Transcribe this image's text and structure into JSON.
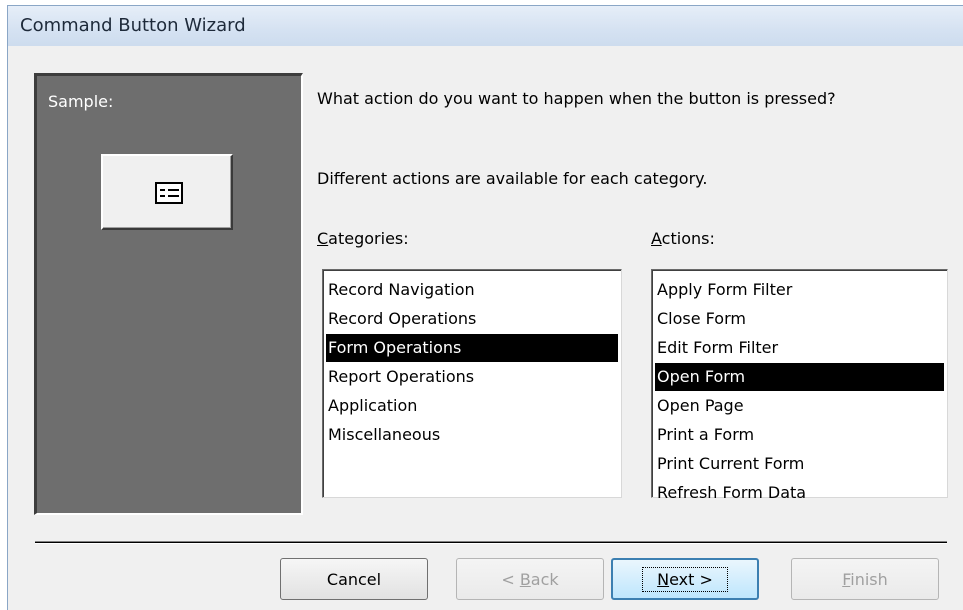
{
  "window": {
    "title": "Command Button Wizard"
  },
  "sample": {
    "label": "Sample:",
    "button_icon": "form-icon"
  },
  "prompt": {
    "question": "What action do you want to happen when the button is pressed?",
    "info": "Different actions are available for each category."
  },
  "categories": {
    "label_prefix": "C",
    "label_rest": "ategories:",
    "items": [
      "Record Navigation",
      "Record Operations",
      "Form Operations",
      "Report Operations",
      "Application",
      "Miscellaneous"
    ],
    "selected": "Form Operations"
  },
  "actions": {
    "label_prefix": "A",
    "label_rest": "ctions:",
    "items": [
      "Apply Form Filter",
      "Close Form",
      "Edit Form Filter",
      "Open Form",
      "Open Page",
      "Print a Form",
      "Print Current Form",
      "Refresh Form Data"
    ],
    "selected": "Open Form"
  },
  "buttons": {
    "cancel": "Cancel",
    "back_pre": "< ",
    "back_key": "B",
    "back_rest": "ack",
    "next_key": "N",
    "next_rest": "ext >",
    "finish_key": "F",
    "finish_rest": "inish"
  },
  "colors": {
    "selection_bg": "#000000",
    "sample_panel": "#6e6e6e",
    "default_button_border": "#3c7fb1"
  }
}
